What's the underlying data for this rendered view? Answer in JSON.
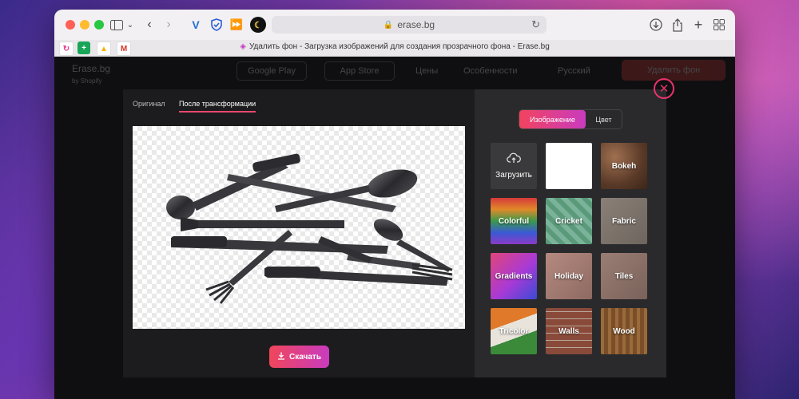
{
  "browser": {
    "url": "erase.bg",
    "tab_title": "Удалить фон - Загрузка изображений для создания прозрачного фона - Erase.bg"
  },
  "site_nav": {
    "logo": "Erase.bg",
    "logo_sub": "by Shopify",
    "google_play": "Google Play",
    "app_store": "App Store",
    "link_prices": "Цены",
    "link_features": "Особенности",
    "link_lang": "Русский",
    "cta": "Удалить фон"
  },
  "modal": {
    "tabs": [
      "Оригинал",
      "После трансформации"
    ],
    "active_tab": "После трансформации",
    "download_label": "Скачать",
    "close_symbol": "✕",
    "segment": {
      "image_label": "Изображение",
      "color_label": "Цвет"
    },
    "tiles": [
      {
        "label": "Загрузить",
        "kind": "upload"
      },
      {
        "label": "",
        "kind": "plain"
      },
      {
        "label": "Bokeh",
        "kind": "bokeh"
      },
      {
        "label": "Colorful",
        "kind": "colorful"
      },
      {
        "label": "Cricket",
        "kind": "cricket"
      },
      {
        "label": "Fabric",
        "kind": "fabric"
      },
      {
        "label": "Gradients",
        "kind": "gradients"
      },
      {
        "label": "Holiday",
        "kind": "holiday"
      },
      {
        "label": "Tiles",
        "kind": "tiles"
      },
      {
        "label": "Tricolor",
        "kind": "tricolor"
      },
      {
        "label": "Walls",
        "kind": "walls"
      },
      {
        "label": "Wood",
        "kind": "wood"
      }
    ]
  },
  "icons": {
    "download": "download-icon",
    "upload": "cloud-upload-icon",
    "close": "close-icon"
  },
  "colors": {
    "accent_start": "#f0465a",
    "accent_end": "#c93bc0",
    "close": "#e6336a"
  }
}
